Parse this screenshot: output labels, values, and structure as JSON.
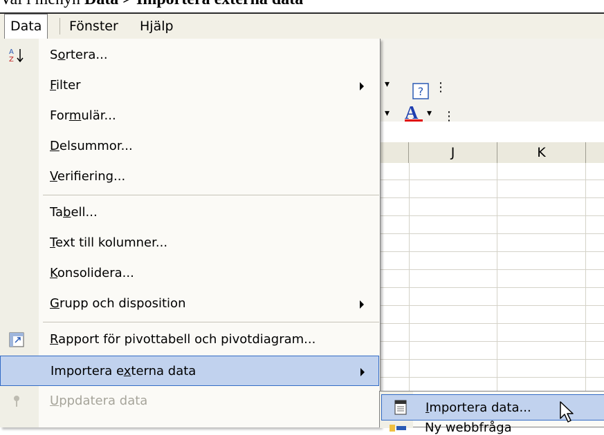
{
  "caption": {
    "prefix": "Val i menyn ",
    "bold": "Data > Importera externa data"
  },
  "menubar": {
    "items": [
      {
        "label": "Data",
        "open": true
      },
      {
        "label": "Fönster"
      },
      {
        "label": "Hjälp"
      }
    ]
  },
  "toolbar": {
    "help_glyph": "?",
    "font_color_glyph": "A",
    "font_color": "#e00000"
  },
  "grid": {
    "columns": [
      "J",
      "K"
    ]
  },
  "data_menu": {
    "items": [
      {
        "pre": "S",
        "u": "o",
        "post": "rtera...",
        "icon": "sort-ascending-icon"
      },
      {
        "pre": "",
        "u": "F",
        "post": "ilter",
        "submenu": true
      },
      {
        "pre": "For",
        "u": "m",
        "post": "ulär..."
      },
      {
        "pre": "",
        "u": "D",
        "post": "elsummor..."
      },
      {
        "pre": "",
        "u": "V",
        "post": "erifiering..."
      },
      {
        "pre": "Ta",
        "u": "b",
        "post": "ell..."
      },
      {
        "pre": "",
        "u": "T",
        "post": "ext till kolumner..."
      },
      {
        "pre": "",
        "u": "K",
        "post": "onsolidera..."
      },
      {
        "pre": "",
        "u": "G",
        "post": "rupp och disposition",
        "submenu": true
      },
      {
        "pre": "",
        "u": "R",
        "post": "apport för pivottabell och pivotdiagram...",
        "icon": "pivot-report-icon"
      },
      {
        "pre": "Importera e",
        "u": "x",
        "post": "terna data",
        "submenu": true,
        "highlight": true
      },
      {
        "pre": "",
        "u": "U",
        "post": "ppdatera data",
        "disabled": true,
        "icon": "refresh-icon"
      }
    ]
  },
  "submenu": {
    "item_pre": "",
    "item_u": "I",
    "item_post": "mportera data...",
    "next_partial": "Ny webbfråga"
  }
}
